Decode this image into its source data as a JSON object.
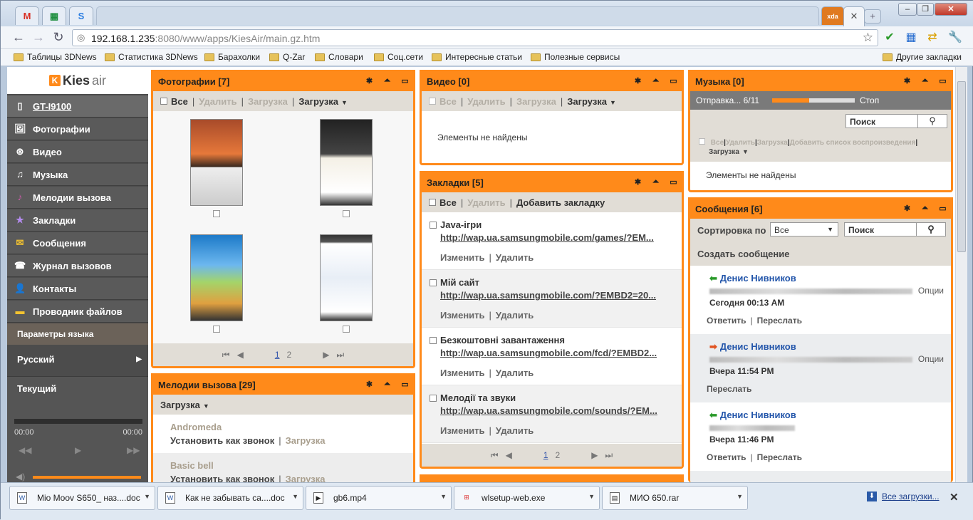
{
  "browser": {
    "pinned_tabs": [
      {
        "icon": "gmail-icon",
        "label": "M",
        "color": "#d93025"
      },
      {
        "icon": "sheets-icon",
        "label": "▦",
        "color": "#1e8e3e"
      },
      {
        "icon": "app-icon",
        "label": "S",
        "color": "#2a7de1"
      }
    ],
    "active_tab_icon_label": "xda",
    "close_tab": "✕",
    "new_tab": "+",
    "window_controls": {
      "minimize": "–",
      "maximize": "❐",
      "close": "✕"
    },
    "url_host": "192.168.1.235",
    "url_rest": ":8080/www/apps/KiesAir/main.gz.htm",
    "bookmarks": [
      "Таблицы 3DNews",
      "Статистика 3DNews",
      "Барахолки",
      "Q-Zar",
      "Словари",
      "Соц.сети",
      "Интересные статьи",
      "Полезные сервисы"
    ],
    "other_bookmarks": "Другие закладки"
  },
  "sidebar": {
    "logo_k": "K",
    "logo_kies": "Kies",
    "logo_air": "air",
    "device": "GT-I9100",
    "items": [
      {
        "label": "Фотографии",
        "icon": "🖼"
      },
      {
        "label": "Видео",
        "icon": "⊛"
      },
      {
        "label": "Музыка",
        "icon": "♫"
      },
      {
        "label": "Мелодии вызова",
        "icon": "♪"
      },
      {
        "label": "Закладки",
        "icon": "★"
      },
      {
        "label": "Сообщения",
        "icon": "✉"
      },
      {
        "label": "Журнал вызовов",
        "icon": "☎"
      },
      {
        "label": "Контакты",
        "icon": "👤"
      },
      {
        "label": "Проводник файлов",
        "icon": "▬"
      }
    ],
    "language_header": "Параметры языка",
    "language_value": "Русский",
    "current_header": "Текущий",
    "time_start": "00:00",
    "time_end": "00:00"
  },
  "panels": {
    "photos": {
      "title": "Фотографии [7]",
      "all": "Все",
      "delete": "Удалить",
      "upload": "Загрузка",
      "download": "Загрузка",
      "pages": [
        "1",
        "2"
      ]
    },
    "video": {
      "title": "Видео [0]",
      "all": "Все",
      "delete": "Удалить",
      "upload": "Загрузка",
      "download": "Загрузка",
      "empty": "Элементы не найдены"
    },
    "music": {
      "title": "Музыка [0]",
      "sending": "Отправка... 6/11",
      "sending_progress": 0.45,
      "stop": "Стоп",
      "search_placeholder": "Поиск",
      "all": "Все",
      "delete": "Удалить",
      "upload": "Загрузка",
      "add_playlist": "Добавить список воспроизведения",
      "download": "Загрузка",
      "empty": "Элементы не найдены"
    },
    "bookmarks": {
      "title": "Закладки [5]",
      "all": "Все",
      "delete": "Удалить",
      "add": "Добавить закладку",
      "edit": "Изменить",
      "remove": "Удалить",
      "items": [
        {
          "title": "Java-ігри",
          "url": "http://wap.ua.samsungmobile.com/games/?EM..."
        },
        {
          "title": "Мій сайт",
          "url": "http://wap.ua.samsungmobile.com/?EMBD2=20..."
        },
        {
          "title": "Безкоштовні завантаження",
          "url": "http://wap.ua.samsungmobile.com/fcd/?EMBD2..."
        },
        {
          "title": "Мелодії та звуки",
          "url": "http://wap.ua.samsungmobile.com/sounds/?EM..."
        }
      ],
      "pages": [
        "1",
        "2"
      ]
    },
    "ringtones": {
      "title": "Мелодии вызова [29]",
      "download": "Загрузка",
      "set_as_ringtone": "Установить как звонок",
      "download_link": "Загрузка",
      "items": [
        "Andromeda",
        "Basic bell"
      ]
    },
    "messages": {
      "title": "Сообщения [6]",
      "sort_by": "Сортировка по",
      "sort_value": "Все",
      "search_placeholder": "Поиск",
      "create": "Создать сообщение",
      "options": "Опции",
      "reply": "Ответить",
      "forward": "Переслать",
      "items": [
        {
          "name": "Денис Нивников",
          "time": "Сегодня 00:13 AM",
          "direction": "in"
        },
        {
          "name": "Денис Нивников",
          "time": "Вчера 11:54 PM",
          "direction": "out"
        },
        {
          "name": "Денис Нивников",
          "time": "Вчера 11:46 PM",
          "direction": "in"
        }
      ]
    }
  },
  "downloads": {
    "items": [
      "Mio Moov S650_ наз....doc",
      "Как не забывать са....doc",
      "gb6.mp4",
      "wlsetup-web.exe",
      "МИО 650.rar"
    ],
    "all": "Все загрузки...",
    "close": "✕"
  },
  "colors": {
    "accent": "#ff8a1a",
    "sidebar": "#4c4c4c",
    "link": "#2255aa"
  }
}
